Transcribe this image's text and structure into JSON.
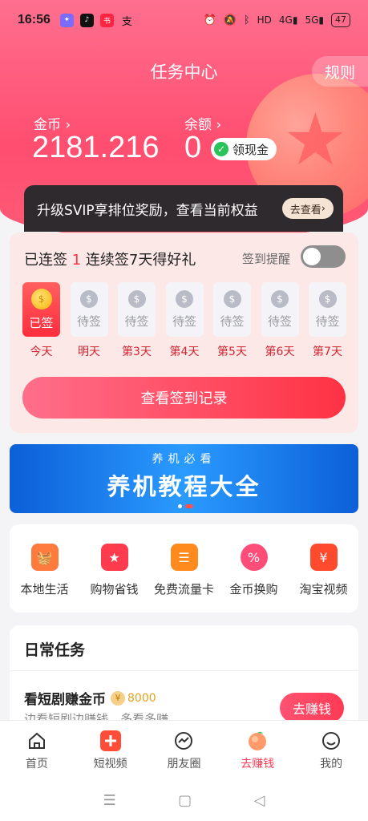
{
  "status_bar": {
    "time": "16:56",
    "battery": "47",
    "apps": [
      "douyin",
      "xiaohongshu",
      "alipay"
    ],
    "signal_labels": [
      "HD",
      "4G",
      "5G"
    ]
  },
  "header": {
    "title": "任务中心",
    "rules_label": "规则"
  },
  "wallet": {
    "coins_label": "金币",
    "coins_value": "2181.216",
    "balance_label": "余额",
    "balance_value": "0",
    "cash_button": "领现金"
  },
  "svip": {
    "text": "升级SVIP享排位奖励，查看当前权益",
    "button": "去查看"
  },
  "signin": {
    "prefix": "已连签",
    "count": "1",
    "suffix": "连续签7天得好礼",
    "remind_label": "签到提醒",
    "remind_on": false,
    "days": [
      {
        "status": "已签",
        "label": "今天",
        "done": true
      },
      {
        "status": "待签",
        "label": "明天",
        "done": false
      },
      {
        "status": "待签",
        "label": "第3天",
        "done": false
      },
      {
        "status": "待签",
        "label": "第4天",
        "done": false
      },
      {
        "status": "待签",
        "label": "第5天",
        "done": false
      },
      {
        "status": "待签",
        "label": "第6天",
        "done": false
      },
      {
        "status": "待签",
        "label": "第7天",
        "done": false
      }
    ],
    "record_button": "查看签到记录"
  },
  "banner": {
    "subtitle": "养机必看",
    "title": "养机教程大全"
  },
  "quick_links": [
    {
      "label": "本地生活",
      "icon": "basket-icon",
      "color": "#ff7a3d"
    },
    {
      "label": "购物省钱",
      "icon": "shopping-bag-icon",
      "color": "#ff3b4e"
    },
    {
      "label": "免费流量卡",
      "icon": "sim-card-icon",
      "color": "#ff8a1e"
    },
    {
      "label": "金币换购",
      "icon": "percent-icon",
      "color": "#ff4d7a"
    },
    {
      "label": "淘宝视频",
      "icon": "red-envelope-icon",
      "color": "#ff4a2e"
    }
  ],
  "tasks": {
    "title": "日常任务",
    "items": [
      {
        "name": "看短剧赚金币",
        "reward": "8000",
        "desc": "边看短剧边赚钱，多看多赚",
        "button": "去赚钱"
      }
    ]
  },
  "tabbar": [
    {
      "label": "首页",
      "icon": "home-icon",
      "active": false
    },
    {
      "label": "短视频",
      "icon": "plus-video-icon",
      "active": false
    },
    {
      "label": "朋友圈",
      "icon": "moments-icon",
      "active": false
    },
    {
      "label": "去赚钱",
      "icon": "peach-icon",
      "active": true
    },
    {
      "label": "我的",
      "icon": "smile-icon",
      "active": false
    }
  ]
}
